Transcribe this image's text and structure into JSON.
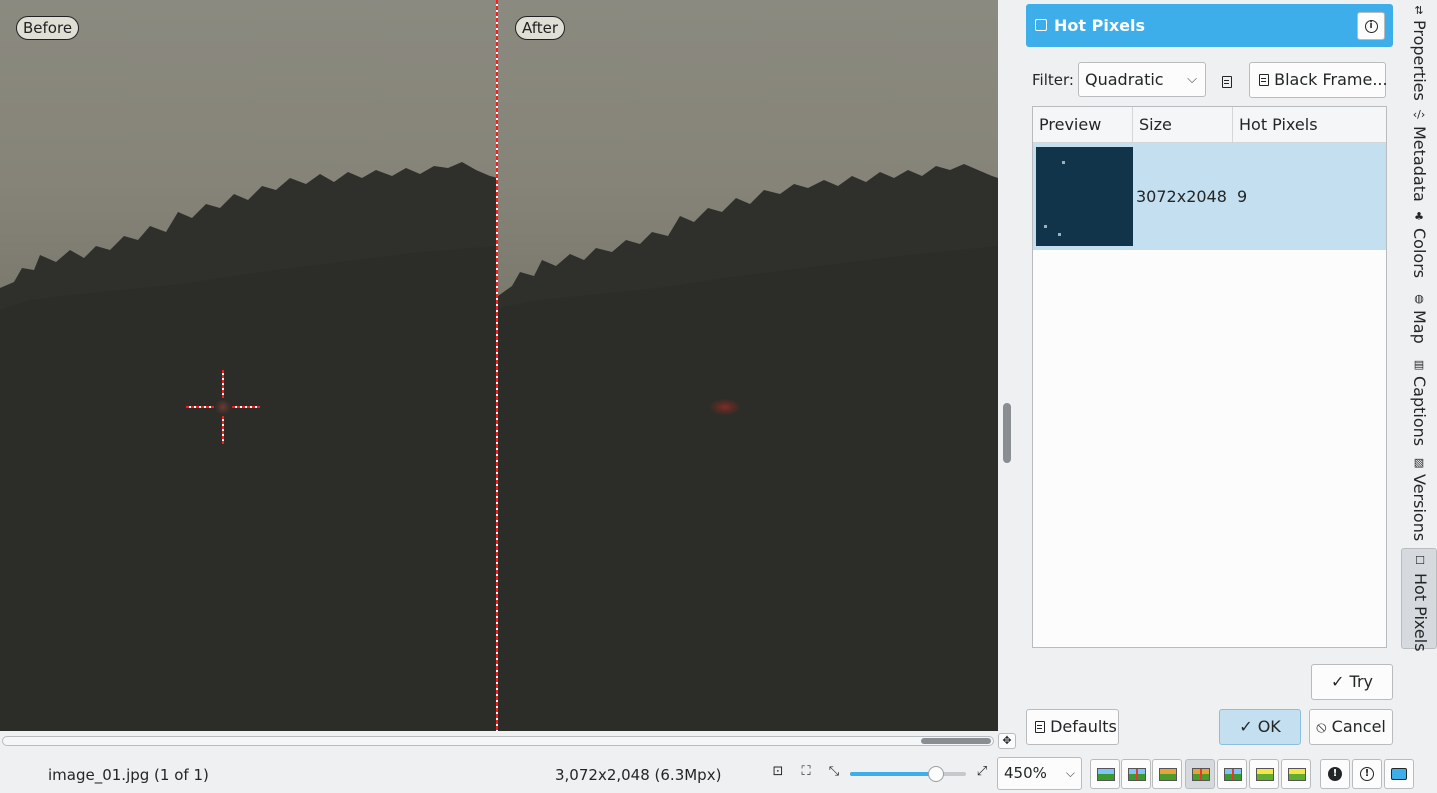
{
  "canvas": {
    "before_label": "Before",
    "after_label": "After"
  },
  "tool": {
    "title": "Hot Pixels",
    "filter_label": "Filter:",
    "filter_value": "Quadratic",
    "black_frame_label": "Black Frame...",
    "table": {
      "columns": [
        "Preview",
        "Size",
        "Hot Pixels"
      ],
      "rows": [
        {
          "size": "3072x2048",
          "hot_pixels": "9"
        }
      ]
    },
    "try_label": "Try",
    "defaults_label": "Defaults",
    "ok_label": "OK",
    "cancel_label": "Cancel"
  },
  "side_tabs": [
    {
      "label": "Properties",
      "icon": "properties-icon"
    },
    {
      "label": "Metadata",
      "icon": "metadata-icon"
    },
    {
      "label": "Colors",
      "icon": "colors-icon"
    },
    {
      "label": "Map",
      "icon": "map-icon"
    },
    {
      "label": "Captions",
      "icon": "captions-icon"
    },
    {
      "label": "Versions",
      "icon": "versions-icon"
    },
    {
      "label": "Hot Pixels",
      "icon": "hot-pixels-icon",
      "active": true
    }
  ],
  "status": {
    "filename": "image_01.jpg (1 of 1)",
    "dimensions": "3,072x2,048 (6.3Mpx)",
    "zoom": "450%",
    "zoom_slider_fraction": 0.74
  },
  "colors": {
    "accent": "#3daee9",
    "selection": "#c3dff0",
    "split_line": "#ff1a1a"
  }
}
